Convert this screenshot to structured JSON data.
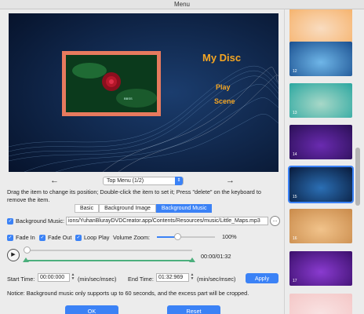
{
  "window": {
    "title": "Menu"
  },
  "preview": {
    "disc_title": "My Disc",
    "items": [
      "Play",
      "Scene"
    ],
    "photo_caption": "BBSS"
  },
  "navigation": {
    "prev_symbol": "←",
    "next_symbol": "→",
    "page_value": "Top Menu (1/2)"
  },
  "hint": "Drag the item to change its position; Double-click the item to set it; Press \"delete\" on the keyboard to remove the item.",
  "tabs": [
    {
      "label": "Basic",
      "active": false
    },
    {
      "label": "Background Image",
      "active": false
    },
    {
      "label": "Background Music",
      "active": true
    }
  ],
  "music": {
    "label": "Background Music:",
    "checked": true,
    "path": "ions/YuhanBlurayDVDCreator.app/Contents/Resources/music/Little_Maps.mp3",
    "more_label": "..."
  },
  "options": {
    "fade_in": "Fade In",
    "fade_out": "Fade Out",
    "loop_play": "Loop Play",
    "volume_label": "Volume Zoom:",
    "volume_value": "100%",
    "volume_fraction": 0.35
  },
  "playback": {
    "time": "00:00/01:32",
    "position_fraction": 0.0
  },
  "range": {
    "start_label": "Start Time:",
    "start_value": "00:00:000",
    "start_unit": "(min/sec/msec)",
    "end_label": "End Time:",
    "end_value": "01:32:969",
    "end_unit": "(min/sec/msec)",
    "apply": "Apply"
  },
  "notice": "Notice: Background music only supports up to 60 seconds, and the excess part will be cropped.",
  "buttons": {
    "ok": "OK",
    "reset": "Reset"
  },
  "sidebar": {
    "thumbnails": [
      {
        "num": "",
        "colors": [
          "#f6b26b",
          "#f9dcc0"
        ]
      },
      {
        "num": "12",
        "colors": [
          "#1a4f8f",
          "#6fb6e8"
        ]
      },
      {
        "num": "13",
        "colors": [
          "#2aa7a0",
          "#a8d8c8"
        ]
      },
      {
        "num": "14",
        "colors": [
          "#2a0f55",
          "#6a2bb0"
        ]
      },
      {
        "num": "15",
        "colors": [
          "#081a3a",
          "#2b6fb5"
        ]
      },
      {
        "num": "16",
        "colors": [
          "#c98a4a",
          "#f1c38b"
        ]
      },
      {
        "num": "17",
        "colors": [
          "#3a0f6a",
          "#8a3bd0"
        ]
      },
      {
        "num": "",
        "colors": [
          "#f4c7c7",
          "#f9e3e3"
        ]
      }
    ],
    "selected_index": 4
  },
  "colors": {
    "accent": "#3b82f6",
    "menu_text": "#f5a623",
    "frame": "#e77a5e",
    "range": "#4caf7d"
  }
}
